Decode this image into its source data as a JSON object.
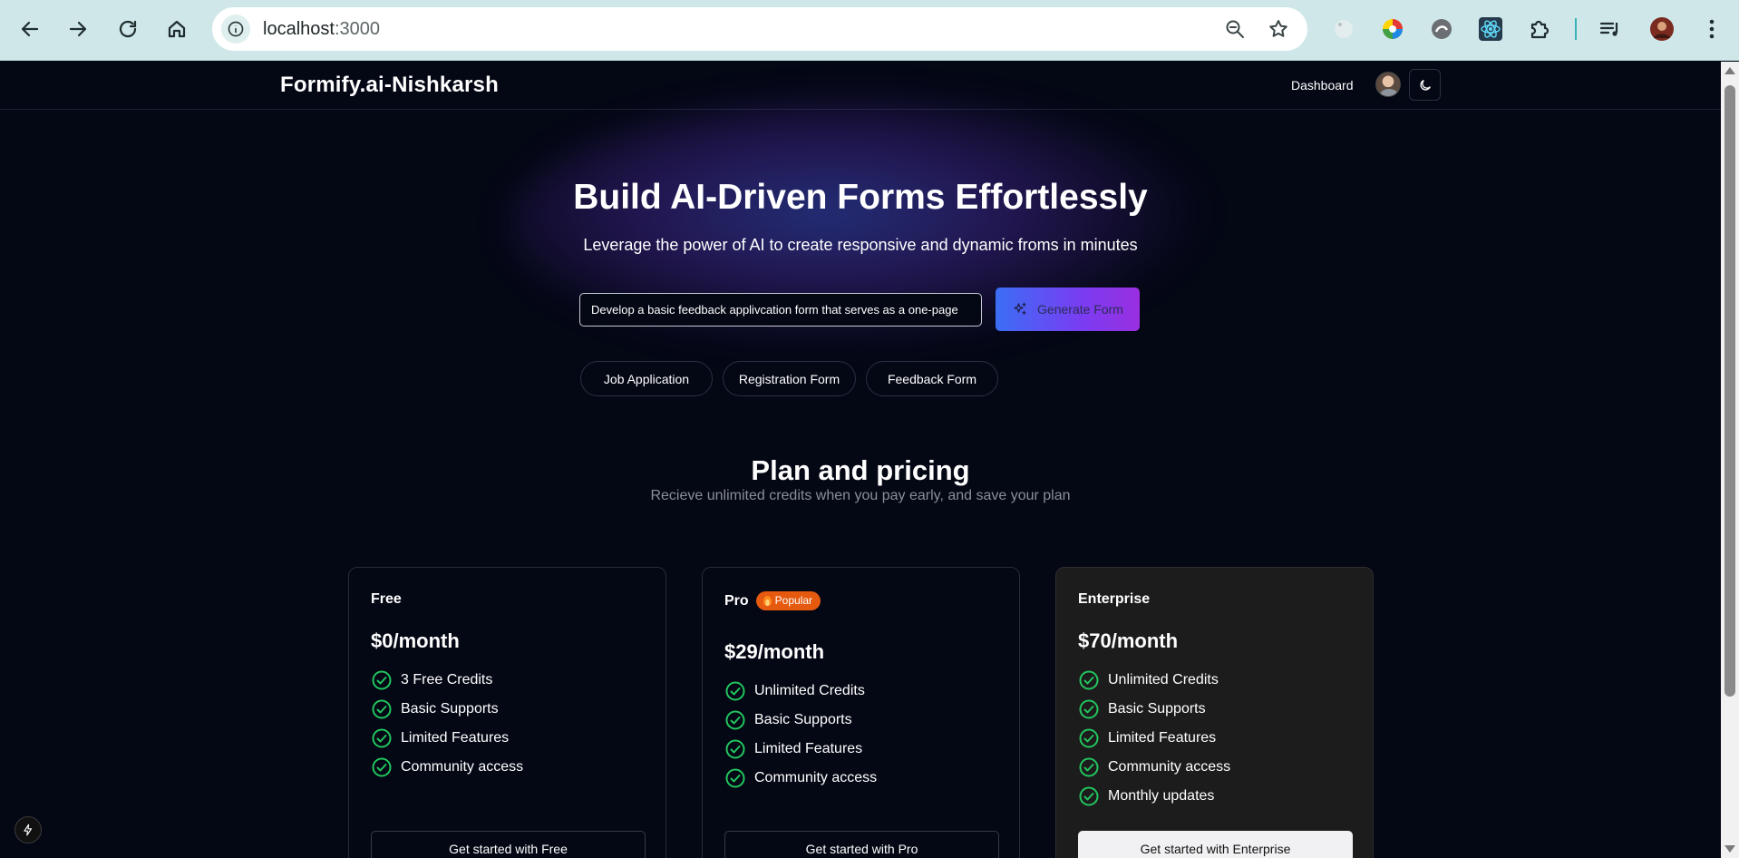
{
  "browser": {
    "url_host": "localhost",
    "url_port": ":3000"
  },
  "header": {
    "brand": "Formify.ai-Nishkarsh",
    "dashboard_label": "Dashboard"
  },
  "hero": {
    "title": "Build AI-Driven Forms Effortlessly",
    "subtitle": "Leverage the power of AI to create responsive and dynamic froms in minutes",
    "prompt_value": "Develop a basic feedback applivcation form that serves as a one-page",
    "generate_label": "Generate Form",
    "chips": [
      "Job Application",
      "Registration Form",
      "Feedback Form"
    ]
  },
  "pricing": {
    "title": "Plan and pricing",
    "subtitle": "Recieve unlimited credits when you pay early, and save your plan",
    "plans": [
      {
        "name": "Free",
        "price": "$0/month",
        "features": [
          "3 Free Credits",
          "Basic Supports",
          "Limited Features",
          "Community access"
        ],
        "cta": "Get started with Free"
      },
      {
        "name": "Pro",
        "badge": "Popular",
        "price": "$29/month",
        "features": [
          "Unlimited Credits",
          "Basic Supports",
          "Limited Features",
          "Community access"
        ],
        "cta": "Get started with Pro"
      },
      {
        "name": "Enterprise",
        "price": "$70/month",
        "features": [
          "Unlimited Credits",
          "Basic Supports",
          "Limited Features",
          "Community access",
          "Monthly updates"
        ],
        "cta": "Get started with Enterprise"
      }
    ]
  },
  "colors": {
    "page_bg": "#040714",
    "check_green": "#22c55e",
    "badge_orange": "#e65a10",
    "gradient_start": "#3b6ef5",
    "gradient_end": "#9a2fe0",
    "browser_chrome": "#cfe7e9"
  },
  "icons": {
    "back": "back-arrow-icon",
    "forward": "forward-arrow-icon",
    "reload": "reload-icon",
    "home": "home-icon",
    "site_info": "info-icon",
    "zoom": "zoom-icon",
    "bookmark": "star-icon",
    "theme": "moon-icon",
    "generate": "sparkles-icon",
    "feature_check": "check-circle-icon",
    "badge": "fire-icon"
  }
}
